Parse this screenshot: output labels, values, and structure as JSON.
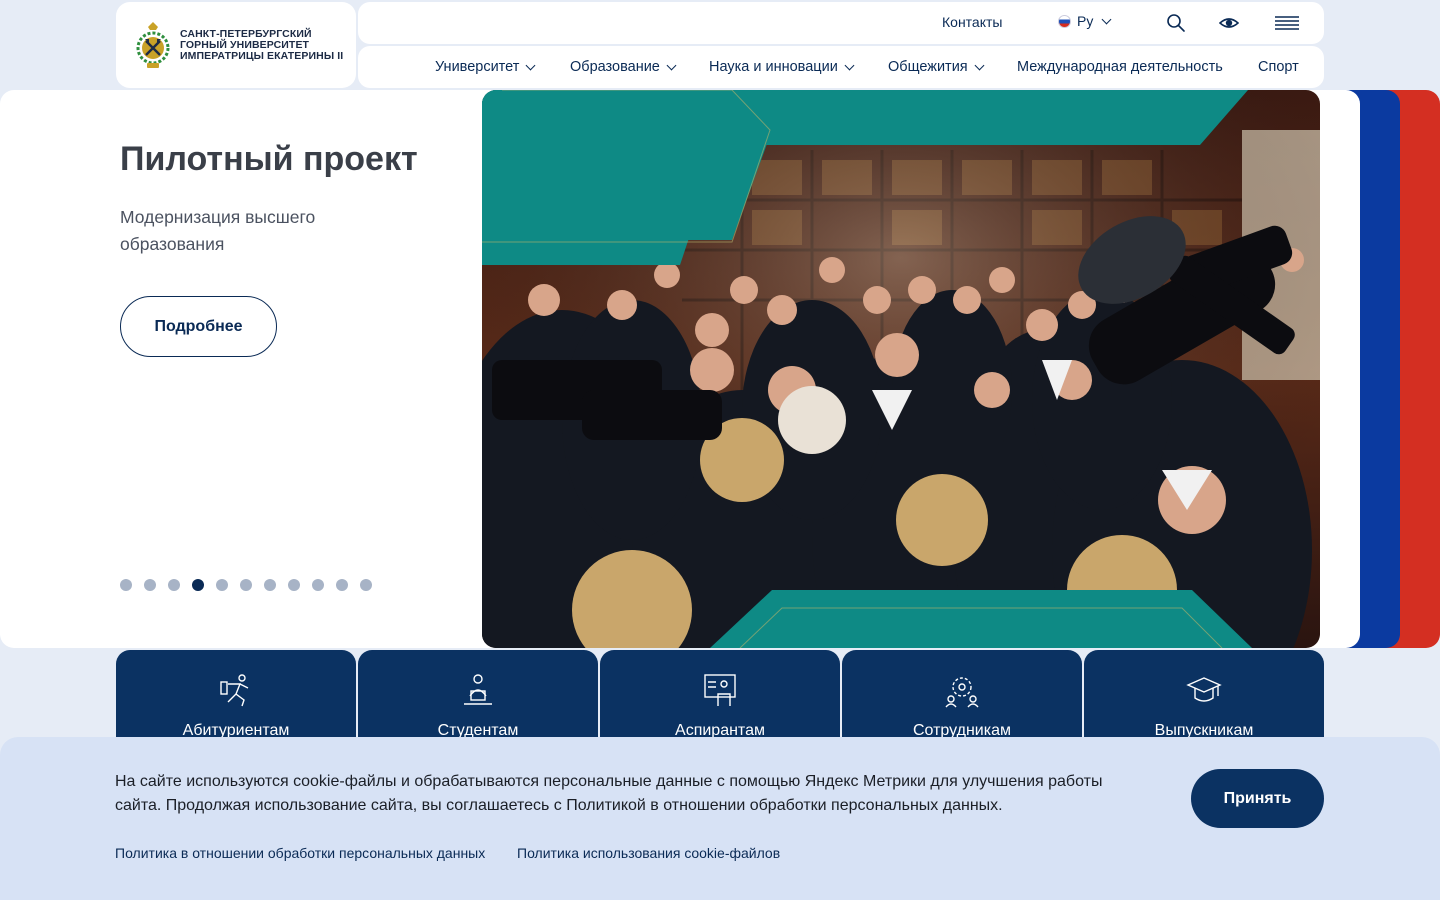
{
  "header": {
    "logo": {
      "line1": "САНКТ-ПЕТЕРБУРГСКИЙ",
      "line2": "ГОРНЫЙ УНИВЕРСИТЕТ",
      "line3": "ИМПЕРАТРИЦЫ ЕКАТЕРИНЫ II"
    },
    "topbar": {
      "contacts": "Контакты",
      "language": "Ру",
      "icons": [
        "search-icon",
        "eye-icon",
        "menu-icon"
      ]
    },
    "nav": [
      {
        "label": "Университет",
        "dropdown": true
      },
      {
        "label": "Образование",
        "dropdown": true
      },
      {
        "label": "Наука и инновации",
        "dropdown": true
      },
      {
        "label": "Общежития",
        "dropdown": true
      },
      {
        "label": "Международная деятельность",
        "dropdown": false
      },
      {
        "label": "Спорт",
        "dropdown": false
      }
    ]
  },
  "hero": {
    "title": "Пилотный проект",
    "subtitle": "Модернизация высшего образования",
    "button": "Подробнее",
    "slides_total": 11,
    "active_slide": 4,
    "colors": {
      "teal": "#0e8a85",
      "stripe_blue": "#0b3aa0",
      "stripe_red": "#d42f22"
    }
  },
  "audience": [
    {
      "label": "Абитуриентам",
      "icon": "applicant-icon"
    },
    {
      "label": "Студентам",
      "icon": "student-icon"
    },
    {
      "label": "Аспирантам",
      "icon": "postgraduate-icon"
    },
    {
      "label": "Сотрудникам",
      "icon": "staff-icon"
    },
    {
      "label": "Выпускникам",
      "icon": "graduate-cap-icon"
    }
  ],
  "cookie": {
    "text": "На сайте используются cookie-файлы и обрабатываются персональные данные с помощью Яндекс Метрики для улучшения работы сайта. Продолжая использование сайта, вы соглашаетесь с Политикой в отношении обработки персональных данных.",
    "accept": "Принять",
    "link1": "Политика в отношении обработки персональных данных",
    "link2": "Политика использования cookie-файлов"
  },
  "colors": {
    "navy": "#0b3262",
    "background": "#e6ecf6",
    "banner": "#d7e2f5"
  }
}
